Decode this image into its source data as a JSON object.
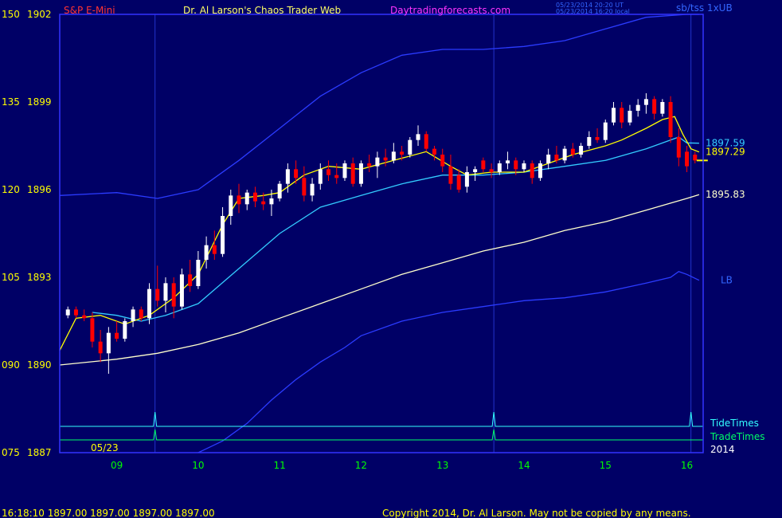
{
  "header": {
    "instrument": "S&P E-Mini",
    "site_title": "Dr. Al Larson's Chaos Trader Web",
    "site_url": "Daytradingforecasts.com",
    "timestamp_utc": "05/23/2014 20:20 UT",
    "timestamp_local": "05/23/2014 16:20 local",
    "bands_label": "sb/tss 1xUB"
  },
  "footer": {
    "quote_line": "16:18:10  1897.00  1897.00  1897.00  1897.00",
    "copyright": "Copyright 2014, Dr. Al Larson. May not be copied by any means."
  },
  "colors": {
    "background": "#000066",
    "frame": "#3333ff",
    "left_axis_text": "#ffff00",
    "bottom_axis_text": "#00ff00",
    "title_red": "#ff3333",
    "title_yellow": "#ffff66",
    "title_magenta": "#ff33ff",
    "band": "#2b3bff",
    "ema_slow": "#ffffcc",
    "ema_mid": "#33ccff",
    "ema_fast": "#ffff00",
    "tide": "#33ffff",
    "trade": "#00ff66",
    "bar_up": "#ffffff",
    "bar_down": "#ff0000"
  },
  "chart_data": {
    "type": "candlestick",
    "title": "S&P E-Mini",
    "date_label": "05/23",
    "year_label": "2014",
    "xlim": [
      8.3,
      16.2
    ],
    "ylim": [
      1887,
      1902
    ],
    "x_ticks": [
      "09",
      "10",
      "11",
      "12",
      "13",
      "14",
      "15",
      "16"
    ],
    "y_ticks": [
      {
        "left": "150",
        "price": "1902",
        "value": 1902
      },
      {
        "left": "135",
        "price": "1899",
        "value": 1899
      },
      {
        "left": "120",
        "price": "1896",
        "value": 1896
      },
      {
        "left": "105",
        "price": "1893",
        "value": 1893
      },
      {
        "left": "090",
        "price": "1890",
        "value": 1890
      },
      {
        "left": "075",
        "price": "1887",
        "value": 1887
      }
    ],
    "vertical_markers": [
      9.47,
      13.63,
      16.05
    ],
    "series": [
      {
        "name": "UB",
        "role": "upper_band",
        "x": [
          8.3,
          9.0,
          9.5,
          10.0,
          10.5,
          11.0,
          11.5,
          12.0,
          12.5,
          13.0,
          13.5,
          14.0,
          14.5,
          15.0,
          15.5,
          16.0,
          16.15
        ],
        "y": [
          1895.8,
          1895.9,
          1895.7,
          1896.0,
          1897.0,
          1898.1,
          1899.2,
          1900.0,
          1900.6,
          1900.8,
          1900.8,
          1900.9,
          1901.1,
          1901.5,
          1901.9,
          1902.2,
          1902.3
        ]
      },
      {
        "name": "LB",
        "role": "lower_band",
        "x": [
          10.0,
          10.3,
          10.6,
          10.9,
          11.2,
          11.5,
          11.8,
          12.0,
          12.5,
          13.0,
          13.5,
          14.0,
          14.5,
          15.0,
          15.5,
          15.8,
          15.9,
          16.0,
          16.15
        ],
        "y": [
          1887.0,
          1887.4,
          1888.0,
          1888.8,
          1889.5,
          1890.1,
          1890.6,
          1891.0,
          1891.5,
          1891.8,
          1892.0,
          1892.2,
          1892.3,
          1892.5,
          1892.8,
          1893.0,
          1893.2,
          1893.1,
          1892.9
        ]
      },
      {
        "name": "1895.83",
        "role": "ema_slow",
        "x": [
          8.3,
          9.0,
          9.5,
          10.0,
          10.5,
          11.0,
          11.5,
          12.0,
          12.5,
          13.0,
          13.5,
          14.0,
          14.5,
          15.0,
          15.5,
          16.0,
          16.15
        ],
        "y": [
          1890.0,
          1890.2,
          1890.4,
          1890.7,
          1891.1,
          1891.6,
          1892.1,
          1892.6,
          1893.1,
          1893.5,
          1893.9,
          1894.2,
          1894.6,
          1894.9,
          1895.3,
          1895.7,
          1895.83
        ]
      },
      {
        "name": "1897.59",
        "role": "ema_mid",
        "x": [
          8.7,
          9.0,
          9.3,
          9.6,
          10.0,
          10.5,
          11.0,
          11.5,
          12.0,
          12.5,
          13.0,
          13.5,
          14.0,
          14.5,
          15.0,
          15.5,
          15.9,
          16.0,
          16.15
        ],
        "y": [
          1891.8,
          1891.7,
          1891.5,
          1891.7,
          1892.1,
          1893.3,
          1894.5,
          1895.4,
          1895.8,
          1896.2,
          1896.5,
          1896.5,
          1896.6,
          1896.8,
          1897.0,
          1897.4,
          1897.8,
          1897.6,
          1897.59
        ]
      },
      {
        "name": "1897.29",
        "role": "ema_fast",
        "x": [
          8.3,
          8.5,
          8.8,
          9.1,
          9.4,
          9.7,
          10.0,
          10.3,
          10.5,
          10.8,
          11.0,
          11.3,
          11.6,
          12.0,
          12.4,
          12.8,
          13.1,
          13.3,
          13.6,
          14.0,
          14.3,
          14.6,
          15.0,
          15.2,
          15.5,
          15.7,
          15.85,
          15.95,
          16.05,
          16.15
        ],
        "y": [
          1890.5,
          1891.6,
          1891.7,
          1891.4,
          1891.7,
          1892.3,
          1893.1,
          1894.8,
          1895.7,
          1895.8,
          1895.9,
          1896.5,
          1896.8,
          1896.7,
          1897.0,
          1897.3,
          1896.8,
          1896.5,
          1896.6,
          1896.6,
          1896.9,
          1897.2,
          1897.5,
          1897.7,
          1898.1,
          1898.4,
          1898.5,
          1897.9,
          1897.4,
          1897.29
        ]
      },
      {
        "name": "TideTimes",
        "role": "tide_times",
        "pulses": [
          9.47,
          13.63,
          16.05
        ]
      },
      {
        "name": "TradeTimes",
        "role": "trade_times",
        "pulses": [
          9.47,
          13.63
        ]
      }
    ],
    "candles": [
      {
        "x": 8.1,
        "o": 1892.0,
        "h": 1892.2,
        "l": 1891.8,
        "c": 1892.0
      },
      {
        "x": 8.2,
        "o": 1891.9,
        "h": 1892.1,
        "l": 1891.7,
        "c": 1891.8
      },
      {
        "x": 8.3,
        "o": 1891.9,
        "h": 1892.0,
        "l": 1891.6,
        "c": 1891.7
      },
      {
        "x": 8.4,
        "o": 1891.7,
        "h": 1892.0,
        "l": 1891.6,
        "c": 1891.9
      },
      {
        "x": 8.5,
        "o": 1891.9,
        "h": 1892.0,
        "l": 1891.6,
        "c": 1891.7
      },
      {
        "x": 8.6,
        "o": 1891.7,
        "h": 1891.9,
        "l": 1891.5,
        "c": 1891.6
      },
      {
        "x": 8.7,
        "o": 1891.6,
        "h": 1891.8,
        "l": 1890.6,
        "c": 1890.8
      },
      {
        "x": 8.8,
        "o": 1890.8,
        "h": 1891.2,
        "l": 1890.1,
        "c": 1890.4
      },
      {
        "x": 8.9,
        "o": 1890.4,
        "h": 1891.3,
        "l": 1889.7,
        "c": 1891.1
      },
      {
        "x": 9.0,
        "o": 1891.1,
        "h": 1891.5,
        "l": 1890.8,
        "c": 1890.9
      },
      {
        "x": 9.1,
        "o": 1890.9,
        "h": 1891.6,
        "l": 1890.8,
        "c": 1891.5
      },
      {
        "x": 9.2,
        "o": 1891.5,
        "h": 1892.0,
        "l": 1891.3,
        "c": 1891.9
      },
      {
        "x": 9.3,
        "o": 1891.9,
        "h": 1892.0,
        "l": 1891.5,
        "c": 1891.6
      },
      {
        "x": 9.4,
        "o": 1891.6,
        "h": 1892.8,
        "l": 1891.4,
        "c": 1892.6
      },
      {
        "x": 9.5,
        "o": 1892.6,
        "h": 1893.4,
        "l": 1892.0,
        "c": 1892.2
      },
      {
        "x": 9.6,
        "o": 1892.2,
        "h": 1893.0,
        "l": 1891.8,
        "c": 1892.8
      },
      {
        "x": 9.7,
        "o": 1892.8,
        "h": 1893.0,
        "l": 1891.6,
        "c": 1892.0
      },
      {
        "x": 9.8,
        "o": 1892.0,
        "h": 1893.3,
        "l": 1891.9,
        "c": 1893.1
      },
      {
        "x": 9.9,
        "o": 1893.1,
        "h": 1893.6,
        "l": 1892.5,
        "c": 1892.7
      },
      {
        "x": 10.0,
        "o": 1892.7,
        "h": 1893.9,
        "l": 1892.6,
        "c": 1893.6
      },
      {
        "x": 10.1,
        "o": 1893.6,
        "h": 1894.4,
        "l": 1893.3,
        "c": 1894.1
      },
      {
        "x": 10.2,
        "o": 1894.1,
        "h": 1894.6,
        "l": 1893.6,
        "c": 1893.8
      },
      {
        "x": 10.3,
        "o": 1893.8,
        "h": 1895.4,
        "l": 1893.7,
        "c": 1895.1
      },
      {
        "x": 10.4,
        "o": 1895.1,
        "h": 1896.0,
        "l": 1894.8,
        "c": 1895.8
      },
      {
        "x": 10.5,
        "o": 1895.8,
        "h": 1896.2,
        "l": 1895.2,
        "c": 1895.5
      },
      {
        "x": 10.6,
        "o": 1895.5,
        "h": 1896.0,
        "l": 1895.3,
        "c": 1895.9
      },
      {
        "x": 10.7,
        "o": 1895.9,
        "h": 1896.1,
        "l": 1895.4,
        "c": 1895.6
      },
      {
        "x": 10.8,
        "o": 1895.6,
        "h": 1895.9,
        "l": 1895.3,
        "c": 1895.5
      },
      {
        "x": 10.9,
        "o": 1895.5,
        "h": 1896.0,
        "l": 1895.1,
        "c": 1895.7
      },
      {
        "x": 11.0,
        "o": 1895.7,
        "h": 1896.3,
        "l": 1895.6,
        "c": 1896.2
      },
      {
        "x": 11.1,
        "o": 1896.2,
        "h": 1896.9,
        "l": 1895.9,
        "c": 1896.7
      },
      {
        "x": 11.2,
        "o": 1896.7,
        "h": 1897.0,
        "l": 1896.2,
        "c": 1896.4
      },
      {
        "x": 11.3,
        "o": 1896.4,
        "h": 1896.8,
        "l": 1895.6,
        "c": 1895.8
      },
      {
        "x": 11.4,
        "o": 1895.8,
        "h": 1896.4,
        "l": 1895.6,
        "c": 1896.2
      },
      {
        "x": 11.5,
        "o": 1896.2,
        "h": 1896.9,
        "l": 1896.0,
        "c": 1896.7
      },
      {
        "x": 11.6,
        "o": 1896.7,
        "h": 1897.0,
        "l": 1896.3,
        "c": 1896.5
      },
      {
        "x": 11.7,
        "o": 1896.5,
        "h": 1896.9,
        "l": 1896.2,
        "c": 1896.4
      },
      {
        "x": 11.8,
        "o": 1896.4,
        "h": 1897.0,
        "l": 1896.3,
        "c": 1896.9
      },
      {
        "x": 11.9,
        "o": 1896.9,
        "h": 1897.1,
        "l": 1896.1,
        "c": 1896.2
      },
      {
        "x": 12.0,
        "o": 1896.2,
        "h": 1897.0,
        "l": 1896.1,
        "c": 1896.9
      },
      {
        "x": 12.1,
        "o": 1896.9,
        "h": 1897.2,
        "l": 1896.6,
        "c": 1896.8
      },
      {
        "x": 12.2,
        "o": 1896.8,
        "h": 1897.3,
        "l": 1896.4,
        "c": 1897.1
      },
      {
        "x": 12.3,
        "o": 1897.1,
        "h": 1897.4,
        "l": 1896.8,
        "c": 1897.0
      },
      {
        "x": 12.4,
        "o": 1897.0,
        "h": 1897.6,
        "l": 1896.9,
        "c": 1897.3
      },
      {
        "x": 12.5,
        "o": 1897.3,
        "h": 1897.5,
        "l": 1897.0,
        "c": 1897.2
      },
      {
        "x": 12.6,
        "o": 1897.2,
        "h": 1897.8,
        "l": 1897.1,
        "c": 1897.7
      },
      {
        "x": 12.7,
        "o": 1897.7,
        "h": 1898.2,
        "l": 1897.5,
        "c": 1897.9
      },
      {
        "x": 12.8,
        "o": 1897.9,
        "h": 1898.0,
        "l": 1897.3,
        "c": 1897.4
      },
      {
        "x": 12.9,
        "o": 1897.4,
        "h": 1897.5,
        "l": 1897.0,
        "c": 1897.2
      },
      {
        "x": 13.0,
        "o": 1897.2,
        "h": 1897.4,
        "l": 1896.6,
        "c": 1896.8
      },
      {
        "x": 13.1,
        "o": 1896.8,
        "h": 1897.2,
        "l": 1896.0,
        "c": 1896.2
      },
      {
        "x": 13.2,
        "o": 1896.5,
        "h": 1896.7,
        "l": 1895.9,
        "c": 1896.0
      },
      {
        "x": 13.3,
        "o": 1896.1,
        "h": 1896.8,
        "l": 1895.9,
        "c": 1896.6
      },
      {
        "x": 13.4,
        "o": 1896.6,
        "h": 1896.8,
        "l": 1896.3,
        "c": 1896.7
      },
      {
        "x": 13.5,
        "o": 1897.0,
        "h": 1897.1,
        "l": 1896.6,
        "c": 1896.7
      },
      {
        "x": 13.6,
        "o": 1896.7,
        "h": 1896.9,
        "l": 1896.4,
        "c": 1896.6
      },
      {
        "x": 13.7,
        "o": 1896.6,
        "h": 1897.0,
        "l": 1896.5,
        "c": 1896.9
      },
      {
        "x": 13.8,
        "o": 1896.9,
        "h": 1897.3,
        "l": 1896.7,
        "c": 1897.0
      },
      {
        "x": 13.9,
        "o": 1897.0,
        "h": 1897.1,
        "l": 1896.5,
        "c": 1896.7
      },
      {
        "x": 14.0,
        "o": 1896.7,
        "h": 1897.0,
        "l": 1896.6,
        "c": 1896.9
      },
      {
        "x": 14.1,
        "o": 1896.9,
        "h": 1897.0,
        "l": 1896.2,
        "c": 1896.4
      },
      {
        "x": 14.2,
        "o": 1896.4,
        "h": 1897.0,
        "l": 1896.3,
        "c": 1896.9
      },
      {
        "x": 14.3,
        "o": 1896.9,
        "h": 1897.4,
        "l": 1896.7,
        "c": 1897.2
      },
      {
        "x": 14.4,
        "o": 1897.2,
        "h": 1897.5,
        "l": 1896.9,
        "c": 1897.0
      },
      {
        "x": 14.5,
        "o": 1897.0,
        "h": 1897.5,
        "l": 1896.9,
        "c": 1897.4
      },
      {
        "x": 14.6,
        "o": 1897.4,
        "h": 1897.6,
        "l": 1897.1,
        "c": 1897.2
      },
      {
        "x": 14.7,
        "o": 1897.2,
        "h": 1897.6,
        "l": 1897.1,
        "c": 1897.5
      },
      {
        "x": 14.8,
        "o": 1897.5,
        "h": 1898.0,
        "l": 1897.4,
        "c": 1897.8
      },
      {
        "x": 14.9,
        "o": 1897.8,
        "h": 1898.1,
        "l": 1897.6,
        "c": 1897.7
      },
      {
        "x": 15.0,
        "o": 1897.7,
        "h": 1898.4,
        "l": 1897.6,
        "c": 1898.3
      },
      {
        "x": 15.1,
        "o": 1898.3,
        "h": 1899.0,
        "l": 1898.2,
        "c": 1898.8
      },
      {
        "x": 15.2,
        "o": 1898.8,
        "h": 1899.0,
        "l": 1898.1,
        "c": 1898.3
      },
      {
        "x": 15.3,
        "o": 1898.3,
        "h": 1898.9,
        "l": 1898.2,
        "c": 1898.7
      },
      {
        "x": 15.4,
        "o": 1898.7,
        "h": 1899.1,
        "l": 1898.5,
        "c": 1898.9
      },
      {
        "x": 15.5,
        "o": 1898.9,
        "h": 1899.3,
        "l": 1898.6,
        "c": 1899.1
      },
      {
        "x": 15.6,
        "o": 1899.1,
        "h": 1899.2,
        "l": 1898.4,
        "c": 1898.6
      },
      {
        "x": 15.7,
        "o": 1898.6,
        "h": 1899.1,
        "l": 1898.5,
        "c": 1899.0
      },
      {
        "x": 15.8,
        "o": 1899.0,
        "h": 1899.2,
        "l": 1897.6,
        "c": 1897.8
      },
      {
        "x": 15.9,
        "o": 1897.8,
        "h": 1898.1,
        "l": 1896.8,
        "c": 1897.1
      },
      {
        "x": 16.0,
        "o": 1897.3,
        "h": 1897.5,
        "l": 1896.6,
        "c": 1896.8
      },
      {
        "x": 16.1,
        "o": 1897.2,
        "h": 1897.3,
        "l": 1896.9,
        "c": 1897.0
      }
    ],
    "last_price": 1897.0
  }
}
